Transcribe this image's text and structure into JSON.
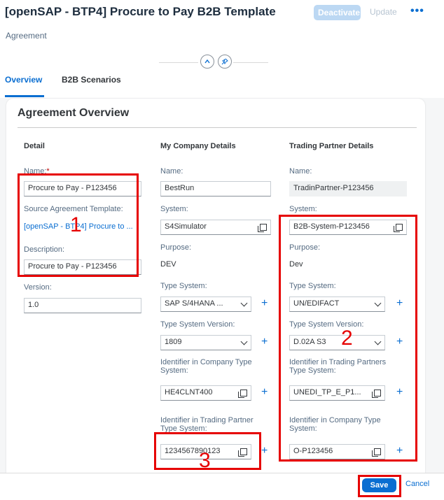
{
  "header": {
    "title": "[openSAP - BTP4] Procure to Pay B2B Template",
    "subtitle": "Agreement",
    "actions": {
      "deactivate": "Deactivate",
      "update": "Update",
      "more": "•••"
    }
  },
  "tabs": [
    {
      "label": "Overview",
      "selected": true
    },
    {
      "label": "B2B Scenarios",
      "selected": false
    }
  ],
  "section": {
    "title": "Agreement Overview"
  },
  "detail": {
    "title": "Detail",
    "name_label": "Name:",
    "required_marker": "*",
    "name_value": "Procure to Pay - P123456",
    "source_template_label": "Source Agreement Template:",
    "source_template_link": "[openSAP - BTP4] Procure to ...",
    "description_label": "Description:",
    "description_value": "Procure to Pay - P123456",
    "version_label": "Version:",
    "version_value": "1.0"
  },
  "company": {
    "title": "My Company Details",
    "name_label": "Name:",
    "name_value": "BestRun",
    "system_label": "System:",
    "system_value": "S4Simulator",
    "purpose_label": "Purpose:",
    "purpose_value": "DEV",
    "type_system_label": "Type System:",
    "type_system_value": "SAP S/4HANA ...",
    "type_system_version_label": "Type System Version:",
    "type_system_version_value": "1809",
    "identifier_company_label_1": "Identifier in Company Type",
    "identifier_company_label_2": "System:",
    "identifier_company_value": "HE4CLNT400",
    "identifier_partner_label_1": "Identifier in Trading Partner",
    "identifier_partner_label_2": "Type System:",
    "identifier_partner_value": "1234567890123"
  },
  "partner": {
    "title": "Trading Partner Details",
    "name_label": "Name:",
    "name_value": "TradinPartner-P123456",
    "system_label": "System:",
    "system_value": "B2B-System-P123456",
    "purpose_label": "Purpose:",
    "purpose_value": "Dev",
    "type_system_label": "Type System:",
    "type_system_value": "UN/EDIFACT",
    "type_system_version_label": "Type System Version:",
    "type_system_version_value": "D.02A S3",
    "identifier_partner_label_1": "Identifier in Trading Partners",
    "identifier_partner_label_2": "Type System:",
    "identifier_partner_value": "UNEDI_TP_E_P1...",
    "identifier_company_label_1": "Identifier in Company Type",
    "identifier_company_label_2": "System:",
    "identifier_company_value": "O-P123456"
  },
  "annotations": {
    "box1": "1",
    "box2": "2",
    "box3": "3"
  },
  "footer": {
    "save": "Save",
    "cancel": "Cancel"
  },
  "colors": {
    "accent": "#0a6ed1",
    "annotation": "#e60000",
    "disabled_button": "#bcd8f3"
  }
}
